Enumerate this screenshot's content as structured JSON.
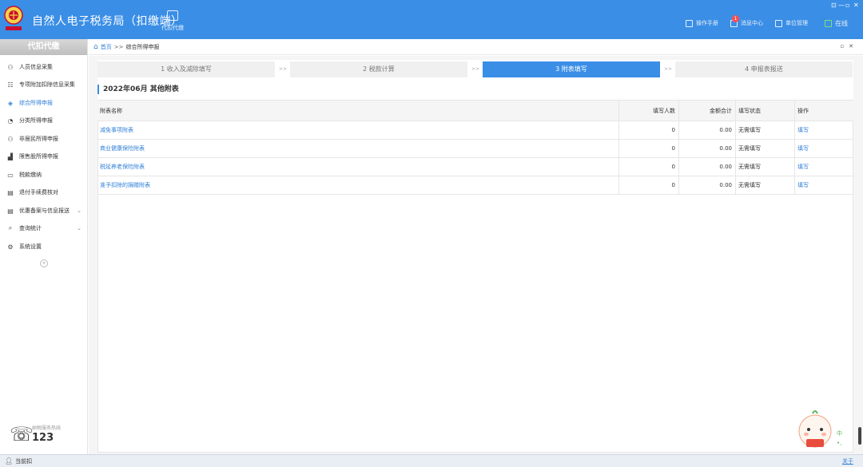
{
  "header": {
    "title": "自然人电子税务局（扣缴端）",
    "nav_daikou": "代扣代缴",
    "manual": "操作手册",
    "messages": "消息中心",
    "message_badge": "1",
    "unit_mgmt": "单位管理",
    "online": "在线",
    "window_controls": [
      "⊡",
      "—",
      "▫",
      "✕"
    ]
  },
  "sidebar": {
    "title": "代扣代缴",
    "items": [
      {
        "label": "人员信息采集",
        "icon": "person-icon"
      },
      {
        "label": "专项附加扣除信息采集",
        "icon": "list-icon"
      },
      {
        "label": "综合所得申报",
        "icon": "layers-icon",
        "active": true
      },
      {
        "label": "分类所得申报",
        "icon": "pie-icon"
      },
      {
        "label": "非居民所得申报",
        "icon": "person-icon"
      },
      {
        "label": "限售股所得申报",
        "icon": "bar-chart-icon"
      },
      {
        "label": "税款缴纳",
        "icon": "folder-icon"
      },
      {
        "label": "退付手续费核对",
        "icon": "document-icon"
      },
      {
        "label": "优惠备案与信息报送",
        "icon": "document-icon",
        "expandable": true
      },
      {
        "label": "查询统计",
        "icon": "search-doc-icon",
        "expandable": true
      },
      {
        "label": "系统设置",
        "icon": "gear-icon"
      }
    ],
    "hotline_label": "纳税服务热线",
    "hotline_number": "123"
  },
  "breadcrumb": {
    "home": "首页",
    "separator": ">>",
    "current": "综合所得申报"
  },
  "steps": [
    {
      "label": "1 收入及减除填写",
      "active": false
    },
    {
      "label": "2 税款计算",
      "active": false
    },
    {
      "label": "3 附表填写",
      "active": true
    },
    {
      "label": "4 申报表报送",
      "active": false
    }
  ],
  "step_separator": ">>",
  "section_title": "2022年06月  其他附表",
  "table": {
    "headers": {
      "name": "附表名称",
      "count": "填写人数",
      "amount": "金额合计",
      "status": "填写状态",
      "op": "操作"
    },
    "rows": [
      {
        "name": "减免事项附表",
        "count": "0",
        "amount": "0.00",
        "status": "无需填写",
        "op": "填写"
      },
      {
        "name": "商业健康保险附表",
        "count": "0",
        "amount": "0.00",
        "status": "无需填写",
        "op": "填写"
      },
      {
        "name": "税延养老保险附表",
        "count": "0",
        "amount": "0.00",
        "status": "无需填写",
        "op": "填写"
      },
      {
        "name": "准予扣除的捐赠附表",
        "count": "0",
        "amount": "0.00",
        "status": "无需填写",
        "op": "填写"
      }
    ]
  },
  "statusbar": {
    "user_label": "当前扣",
    "about": "关于"
  },
  "float": {
    "lang": "中",
    "extra": "•,"
  },
  "colors": {
    "header_bg": "#3a8ee6",
    "accent": "#2f7fd8",
    "active_step": "#3a8ee6"
  }
}
